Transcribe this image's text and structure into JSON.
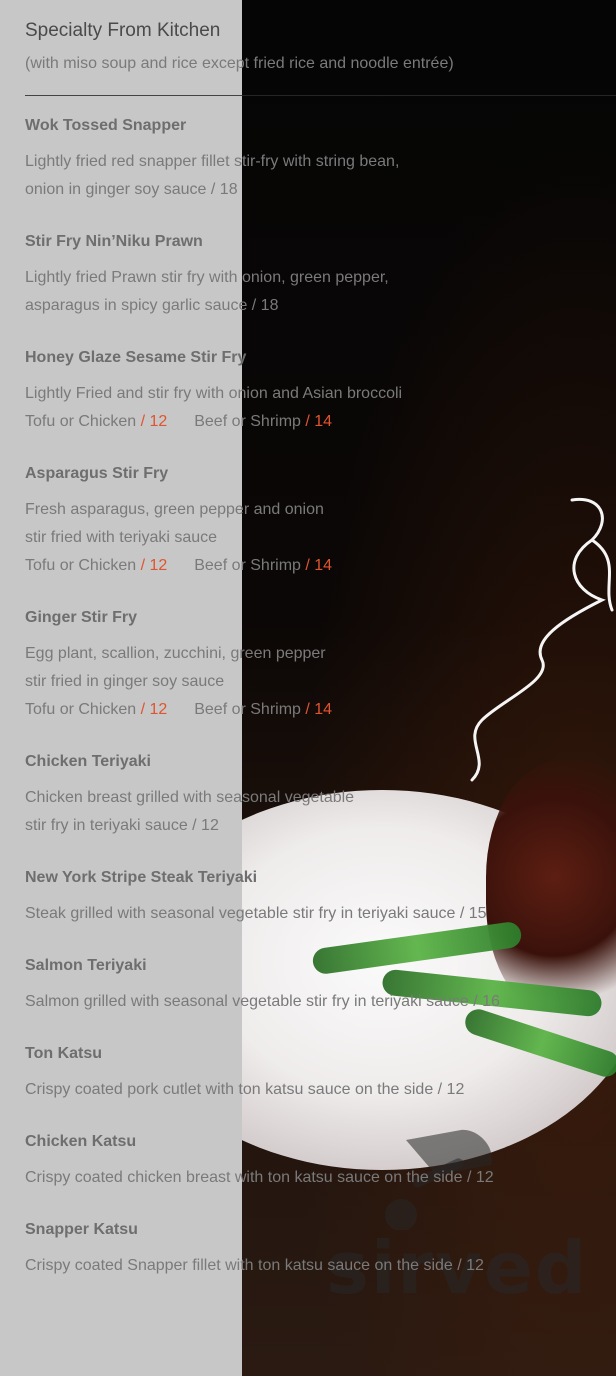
{
  "header": {
    "title": "Specialty From Kitchen",
    "subtitle": "(with miso soup and rice except fried rice and noodle entrée)"
  },
  "items": [
    {
      "name": "Wok Tossed Snapper",
      "desc": "Lightly fried red snapper fillet stir-fry with string bean,\nonion in ginger soy sauce / 18"
    },
    {
      "name": "Stir Fry Nin’Niku Prawn",
      "desc": "Lightly fried Prawn stir fry with onion, green pepper,\nasparagus in spicy garlic sauce / 18"
    },
    {
      "name": "Honey Glaze Sesame Stir Fry",
      "desc": "Lightly Fried and stir fry with onion and Asian broccoli",
      "prices": {
        "label1": "Tofu or Chicken",
        "price1": "/ 12",
        "label2": "Beef or Shrimp",
        "price2": "/ 14"
      }
    },
    {
      "name": "Asparagus Stir Fry",
      "desc": "Fresh asparagus, green pepper and onion\nstir fried with teriyaki sauce",
      "prices": {
        "label1": "Tofu or Chicken",
        "price1": "/ 12",
        "label2": "Beef or Shrimp",
        "price2": "/ 14"
      }
    },
    {
      "name": "Ginger Stir Fry",
      "desc": "Egg plant, scallion, zucchini, green pepper\nstir fried in ginger soy sauce",
      "prices": {
        "label1": "Tofu or Chicken",
        "price1": "/ 12",
        "label2": "Beef or Shrimp",
        "price2": "/ 14"
      }
    },
    {
      "name": "Chicken Teriyaki",
      "desc": "Chicken breast grilled with seasonal vegetable\nstir fry in teriyaki sauce / 12"
    },
    {
      "name": "New York Stripe Steak Teriyaki",
      "desc": "Steak grilled with seasonal vegetable stir fry in teriyaki sauce / 15"
    },
    {
      "name": "Salmon Teriyaki",
      "desc": "Salmon grilled with seasonal vegetable stir fry in teriyaki sauce / 16"
    },
    {
      "name": "Ton Katsu",
      "desc": "Crispy coated pork cutlet with ton katsu sauce on the side / 12"
    },
    {
      "name": "Chicken Katsu",
      "desc": "Crispy coated chicken breast with ton katsu sauce on the side / 12"
    },
    {
      "name": "Snapper Katsu",
      "desc": "Crispy coated Snapper fillet with ton katsu sauce on the side / 12"
    }
  ],
  "watermark": {
    "text": "sirved"
  },
  "colors": {
    "accent_price": "#e0542f"
  },
  "icons": {
    "watermark_icon": "fork-spoon-icon"
  }
}
